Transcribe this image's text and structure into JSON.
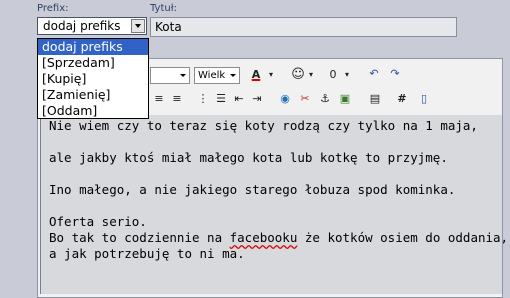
{
  "labels": {
    "prefix": "Prefix:",
    "title": "Tytuł:"
  },
  "prefix_select": {
    "value": "dodaj prefiks"
  },
  "title_input": {
    "value": "Kota"
  },
  "dropdown": {
    "options": [
      "dodaj prefiks",
      "[Sprzedam]",
      "[Kupię]",
      "[Zamienię]",
      "[Oddam]"
    ],
    "selected_index": 0
  },
  "toolbar": {
    "size_select": "Wielk",
    "font_color_letter": "A",
    "hash": "#"
  },
  "content": {
    "lines": [
      "Nie wiem czy to teraz się koty rodzą czy tylko na 1 maja,",
      "",
      "ale jakby ktoś miał małego kota lub kotkę to przyjmę.",
      "",
      "Ino małego, a nie jakiego starego łobuza spod kominka.",
      "",
      "Oferta serio.",
      "Bo tak to codziennie na facebooku że kotków osiem do oddania,",
      "a jak potrzebuję to ni ma."
    ],
    "line8_before": "Bo tak to codziennie na ",
    "line8_spell": "facebooku",
    "line8_after": " że kotków osiem do oddania,"
  }
}
